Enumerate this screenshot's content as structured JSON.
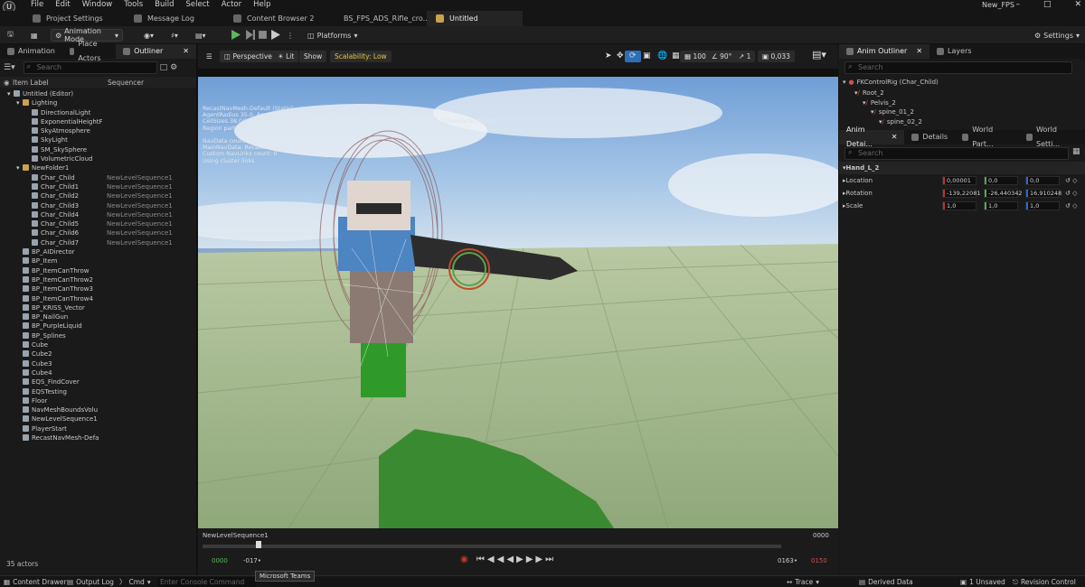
{
  "menu": [
    "File",
    "Edit",
    "Window",
    "Tools",
    "Build",
    "Select",
    "Actor",
    "Help"
  ],
  "project_name": "New_FPS",
  "doc_tabs": [
    "Project Settings",
    "Message Log",
    "Content Browser 2",
    "BS_FPS_ADS_Rifle_cro...",
    "Untitled"
  ],
  "toolbar": {
    "mode": "Animation Mode",
    "platforms": "Platforms",
    "settings": "Settings"
  },
  "left_tabs": [
    "Animation",
    "Place Actors",
    "Outliner"
  ],
  "left_search": "Search",
  "col_headers": {
    "label": "Item Label",
    "sequencer": "Sequencer"
  },
  "outliner": [
    {
      "label": "Untitled (Editor)",
      "depth": 0,
      "type": "world",
      "seq": ""
    },
    {
      "label": "Lighting",
      "depth": 1,
      "type": "folder",
      "seq": ""
    },
    {
      "label": "DirectionalLight",
      "depth": 2,
      "type": "actor",
      "seq": ""
    },
    {
      "label": "ExponentialHeightF",
      "depth": 2,
      "type": "actor",
      "seq": ""
    },
    {
      "label": "SkyAtmosphere",
      "depth": 2,
      "type": "actor",
      "seq": ""
    },
    {
      "label": "SkyLight",
      "depth": 2,
      "type": "actor",
      "seq": ""
    },
    {
      "label": "SM_SkySphere",
      "depth": 2,
      "type": "actor",
      "seq": ""
    },
    {
      "label": "VolumetricCloud",
      "depth": 2,
      "type": "actor",
      "seq": ""
    },
    {
      "label": "NewFolder1",
      "depth": 1,
      "type": "folder",
      "seq": ""
    },
    {
      "label": "Char_Child",
      "depth": 2,
      "type": "actor",
      "seq": "NewLevelSequence1"
    },
    {
      "label": "Char_Child1",
      "depth": 2,
      "type": "actor",
      "seq": "NewLevelSequence1"
    },
    {
      "label": "Char_Child2",
      "depth": 2,
      "type": "actor",
      "seq": "NewLevelSequence1"
    },
    {
      "label": "Char_Child3",
      "depth": 2,
      "type": "actor",
      "seq": "NewLevelSequence1"
    },
    {
      "label": "Char_Child4",
      "depth": 2,
      "type": "actor",
      "seq": "NewLevelSequence1"
    },
    {
      "label": "Char_Child5",
      "depth": 2,
      "type": "actor",
      "seq": "NewLevelSequence1"
    },
    {
      "label": "Char_Child6",
      "depth": 2,
      "type": "actor",
      "seq": "NewLevelSequence1"
    },
    {
      "label": "Char_Child7",
      "depth": 2,
      "type": "actor",
      "seq": "NewLevelSequence1"
    },
    {
      "label": "BP_AIDirector",
      "depth": 1,
      "type": "actor",
      "seq": ""
    },
    {
      "label": "BP_Item",
      "depth": 1,
      "type": "actor",
      "seq": ""
    },
    {
      "label": "BP_ItemCanThrow",
      "depth": 1,
      "type": "actor",
      "seq": ""
    },
    {
      "label": "BP_ItemCanThrow2",
      "depth": 1,
      "type": "actor",
      "seq": ""
    },
    {
      "label": "BP_ItemCanThrow3",
      "depth": 1,
      "type": "actor",
      "seq": ""
    },
    {
      "label": "BP_ItemCanThrow4",
      "depth": 1,
      "type": "actor",
      "seq": ""
    },
    {
      "label": "BP_KRISS_Vector",
      "depth": 1,
      "type": "actor",
      "seq": ""
    },
    {
      "label": "BP_NailGun",
      "depth": 1,
      "type": "actor",
      "seq": ""
    },
    {
      "label": "BP_PurpleLiquid",
      "depth": 1,
      "type": "actor",
      "seq": ""
    },
    {
      "label": "BP_Splines",
      "depth": 1,
      "type": "actor",
      "seq": ""
    },
    {
      "label": "Cube",
      "depth": 1,
      "type": "actor",
      "seq": ""
    },
    {
      "label": "Cube2",
      "depth": 1,
      "type": "actor",
      "seq": ""
    },
    {
      "label": "Cube3",
      "depth": 1,
      "type": "actor",
      "seq": ""
    },
    {
      "label": "Cube4",
      "depth": 1,
      "type": "actor",
      "seq": ""
    },
    {
      "label": "EQS_FindCover",
      "depth": 1,
      "type": "actor",
      "seq": ""
    },
    {
      "label": "EQSTesting",
      "depth": 1,
      "type": "actor",
      "seq": ""
    },
    {
      "label": "Floor",
      "depth": 1,
      "type": "actor",
      "seq": ""
    },
    {
      "label": "NavMeshBoundsVolu",
      "depth": 1,
      "type": "actor",
      "seq": ""
    },
    {
      "label": "NewLevelSequence1",
      "depth": 1,
      "type": "actor",
      "seq": ""
    },
    {
      "label": "PlayerStart",
      "depth": 1,
      "type": "actor",
      "seq": ""
    },
    {
      "label": "RecastNavMesh-Defa",
      "depth": 1,
      "type": "actor",
      "seq": ""
    }
  ],
  "actor_count": "35 actors",
  "viewport": {
    "perspective": "Perspective",
    "lit": "Lit",
    "show": "Show",
    "scalability": "Scalability: Low",
    "grid": "100",
    "angle": "90°",
    "scale": "1",
    "speed": "0,033",
    "overlay": "RecastNavMesh-Default (Static)\nAgentRadius 35.0, AgentHeight 144.0\nCellSizes 38.0/19.0/19.0, CellHeights 10.0/10.0/10.0, AgentMaxStepHeight 35.0/35.0 (low/default/high)\nRegion part Watershed, Layer part Watershed\n\nNavData count: 1\nMainNavData: RecastNavMesh-Default\nCustom NavLinks count: 0\nUsing cluster links"
  },
  "sequencer": {
    "name": "NewLevelSequence1",
    "end_frame": "0000",
    "start": "0000",
    "current": "-017•",
    "end": "0163•",
    "end2": "0150"
  },
  "anim_outliner": {
    "tabs": [
      "Anim Outliner",
      "Layers"
    ],
    "search": "Search",
    "rig": "FKControlRig  (Char_Child)",
    "bones": [
      {
        "label": "Root_2",
        "depth": 1
      },
      {
        "label": "Pelvis_2",
        "depth": 2
      },
      {
        "label": "spine_01_2",
        "depth": 3
      },
      {
        "label": "spine_02_2",
        "depth": 4
      }
    ]
  },
  "details": {
    "tabs": [
      "Anim Detai...",
      "Details",
      "World Part...",
      "World Setti..."
    ],
    "search": "Search",
    "section": "Hand_L_2",
    "rows": [
      {
        "label": "Location",
        "x": "0,00001",
        "y": "0,0",
        "z": "0,0"
      },
      {
        "label": "Rotation",
        "x": "-139,22081",
        "y": "-26,440342",
        "z": "16,910248"
      },
      {
        "label": "Scale",
        "x": "1,0",
        "y": "1,0",
        "z": "1,0"
      }
    ]
  },
  "status": {
    "content_drawer": "Content Drawer",
    "output_log": "Output Log",
    "cmd": "Cmd",
    "console_placeholder": "Enter Console Command",
    "trace": "Trace",
    "derived": "Derived Data",
    "unsaved": "1 Unsaved",
    "revision": "Revision Control"
  },
  "tooltip": "Microsoft Teams"
}
